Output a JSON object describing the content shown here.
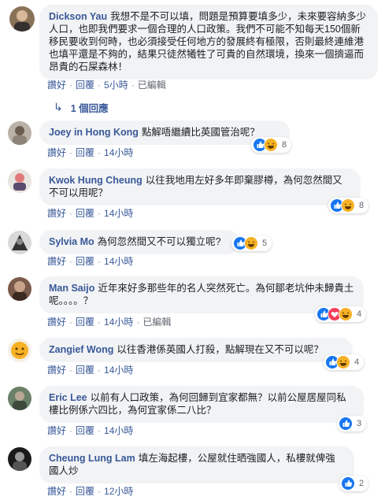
{
  "comments": [
    {
      "author": "Dickson Yau",
      "text": "我想不是不可以填，問題是預算要填多少，未來要容納多少人口，也即我們要求一個合理的人口政策。我們不可能不知每天150個新移民要收到何時，也必須接受任何地方的發展終有極限，否則最終連維港也填平還是不夠的，結果只徒然犧牲了可貴的自然環境，換來一個擠逼而昂貴的石屎森林！",
      "like": "讚好",
      "reply": "回覆",
      "time": "5小時",
      "edited": "已編輯"
    },
    {
      "author": "Joey in Hong Kong",
      "text": "點解唔繼續比英國管治呢？",
      "like": "讚好",
      "reply": "回覆",
      "time": "14小時",
      "count": "8"
    },
    {
      "author": "Kwok Hung Cheung",
      "text": "以往我地用左好多年即棄膠樽，為何忽然間又不可以用呢？",
      "like": "讚好",
      "reply": "回覆",
      "time": "14小時",
      "count": "8"
    },
    {
      "author": "Sylvia Mo",
      "text": "為何忽然間又不可以獨立呢?",
      "like": "讚好",
      "reply": "回覆",
      "time": "14小時",
      "count": "5"
    },
    {
      "author": "Man Saijo",
      "text": "近年來好多那些年的名人突然死亡。為何鄒老坑仲未歸貴土呢。。。。？",
      "like": "讚好",
      "reply": "回覆",
      "time": "14小時",
      "edited": "已編輯",
      "count": "4"
    },
    {
      "author": "Zangief Wong",
      "text": "以往香港係英國人打殺，點解現在又不可以呢？",
      "like": "讚好",
      "reply": "回覆",
      "time": "14小時",
      "count": "4"
    },
    {
      "author": "Eric Lee",
      "text": "以前有人口政策，為何回歸到宜家都無？以前公屋居屋同私樓比例係六四比，為何宜家係二八比？",
      "like": "讚好",
      "reply": "回覆",
      "time": "14小時",
      "count": "3"
    },
    {
      "author": "Cheung Lung Lam",
      "text": "填左海起樓，公屋就住晒強國人，私樓就俾強國人炒",
      "like": "讚好",
      "reply": "回覆",
      "time": "12小時",
      "count": "2"
    }
  ],
  "replies_link": "1 個回應",
  "reply_arrow": "↳",
  "dot": "·",
  "colors": {
    "link": "#385898",
    "bubble": "#f2f3f5",
    "meta": "#606770",
    "like_blue": "#1877f2",
    "haha_yellow": "#f7b125",
    "love_red": "#f33e58"
  },
  "icons": [
    "like-icon",
    "haha-icon",
    "love-icon",
    "reply-arrow-icon"
  ]
}
